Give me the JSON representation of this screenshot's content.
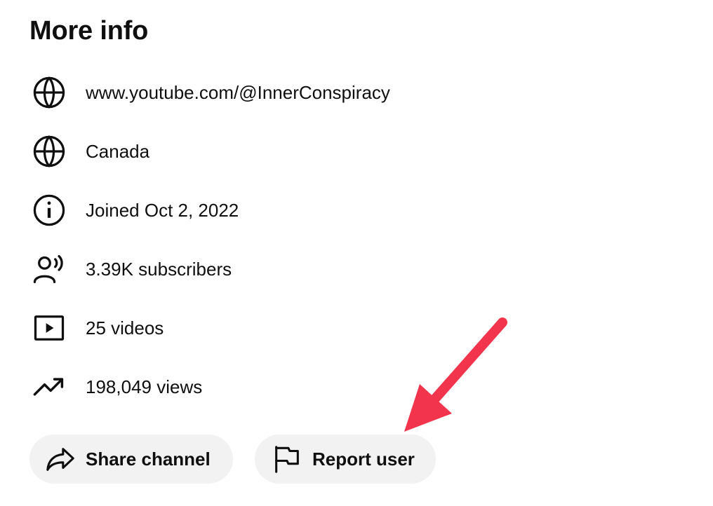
{
  "section": {
    "title": "More info"
  },
  "info_rows": [
    {
      "icon": "globe-icon",
      "text": "www.youtube.com/@InnerConspiracy"
    },
    {
      "icon": "globe-icon",
      "text": "Canada"
    },
    {
      "icon": "info-icon",
      "text": "Joined Oct 2, 2022"
    },
    {
      "icon": "subscribers-icon",
      "text": "3.39K subscribers"
    },
    {
      "icon": "video-icon",
      "text": "25 videos"
    },
    {
      "icon": "trending-icon",
      "text": "198,049 views"
    }
  ],
  "actions": {
    "share_label": "Share channel",
    "share_icon": "share-icon",
    "report_label": "Report user",
    "report_icon": "flag-icon"
  },
  "annotation": {
    "arrow_color": "#f2344c"
  }
}
